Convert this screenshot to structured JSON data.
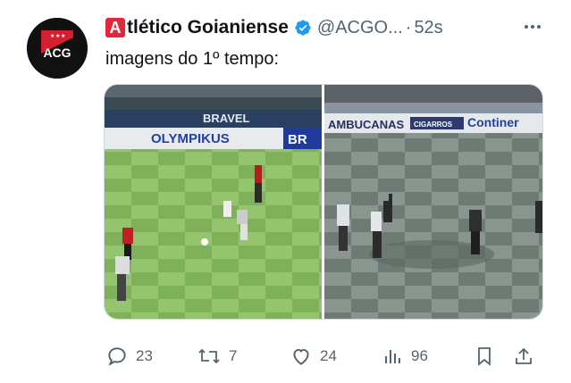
{
  "tweet": {
    "display_name_badge": "A",
    "display_name": "tlético Goianiense",
    "handle": "@ACGO...",
    "separator": "·",
    "time": "52s",
    "text": "imagens do 1º tempo:",
    "avatar_letters": "ACG"
  },
  "media": {
    "left_banners": [
      "OLYMPIKUS",
      "BR"
    ],
    "right_banners": [
      "AMBUCANAS",
      "CIGARROS",
      "Continer"
    ]
  },
  "actions": {
    "replies": "23",
    "reposts": "7",
    "likes": "24",
    "views": "96"
  },
  "icons": [
    "verified-badge-icon",
    "more-icon",
    "reply-icon",
    "repost-icon",
    "like-icon",
    "views-icon",
    "bookmark-icon",
    "share-icon"
  ],
  "colors": {
    "verified": "#1d9bf0",
    "badge_red": "#e0283a",
    "muted": "#536471"
  }
}
